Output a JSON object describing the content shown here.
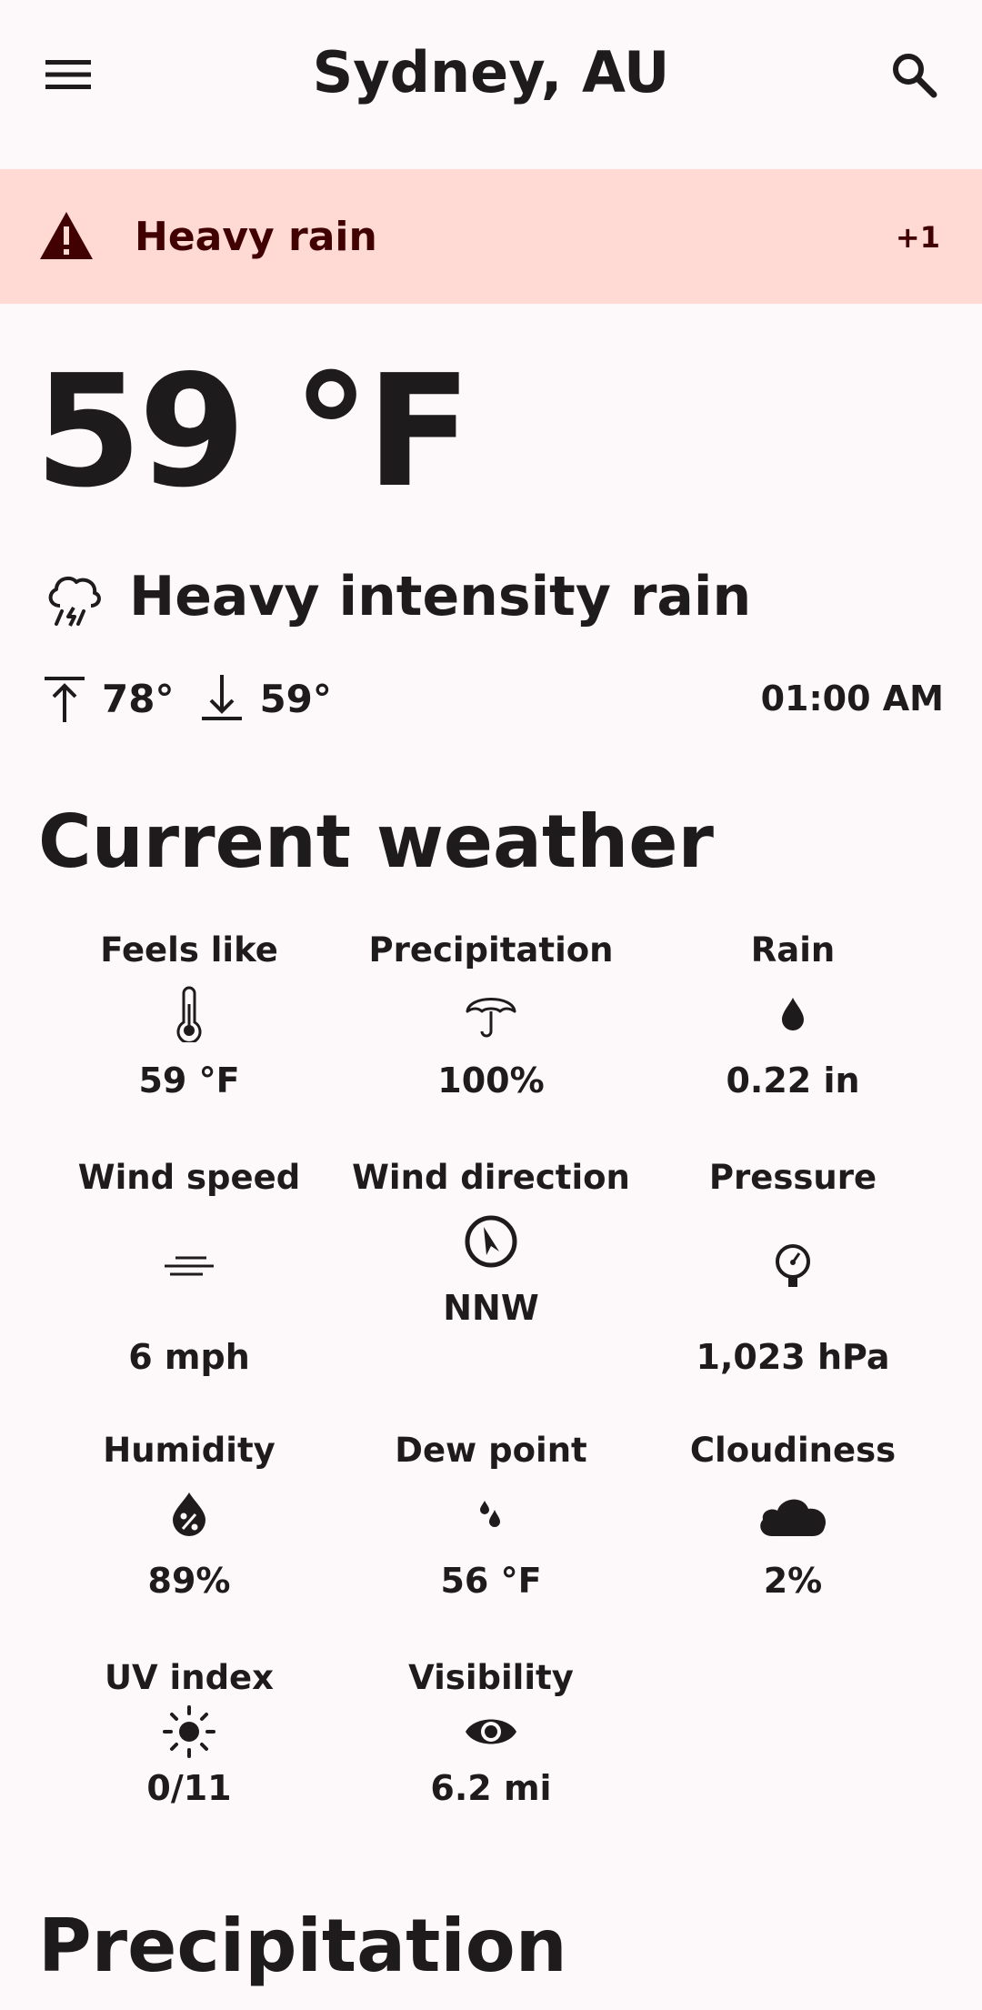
{
  "app_bar": {
    "title": "Sydney, AU",
    "menu_icon": "menu-icon",
    "search_icon": "search-icon"
  },
  "alert": {
    "title": "Heavy rain",
    "count": "+1",
    "icon": "warning-icon",
    "background": "#ffdad5",
    "text_color": "#410002"
  },
  "current": {
    "temperature": "59 °F",
    "condition": "Heavy intensity rain",
    "condition_icon": "thunderstorm-rain-icon",
    "high": "78°",
    "low": "59°",
    "time": "01:00 AM"
  },
  "sections": {
    "current_weather": "Current weather",
    "precipitation": "Precipitation"
  },
  "metrics": [
    {
      "label": "Feels like",
      "value": "59 °F",
      "icon": "thermometer-icon"
    },
    {
      "label": "Precipitation",
      "value": "100%",
      "icon": "umbrella-icon"
    },
    {
      "label": "Rain",
      "value": "0.22 in",
      "icon": "water-drop-icon"
    },
    {
      "label": "Wind speed",
      "value": "6 mph",
      "icon": "wind-icon"
    },
    {
      "label": "Wind direction",
      "value": "NNW",
      "icon": "compass-icon"
    },
    {
      "label": "Pressure",
      "value": "1,023 hPa",
      "icon": "gauge-icon"
    },
    {
      "label": "Humidity",
      "value": "89%",
      "icon": "humidity-icon"
    },
    {
      "label": "Dew point",
      "value": "56 °F",
      "icon": "dew-drops-icon"
    },
    {
      "label": "Cloudiness",
      "value": "2%",
      "icon": "cloud-icon"
    },
    {
      "label": "UV index",
      "value": "0/11",
      "icon": "sun-icon"
    },
    {
      "label": "Visibility",
      "value": "6.2 mi",
      "icon": "eye-icon"
    }
  ],
  "colors": {
    "background": "#fdf8fa",
    "text": "#1d1b1b"
  }
}
